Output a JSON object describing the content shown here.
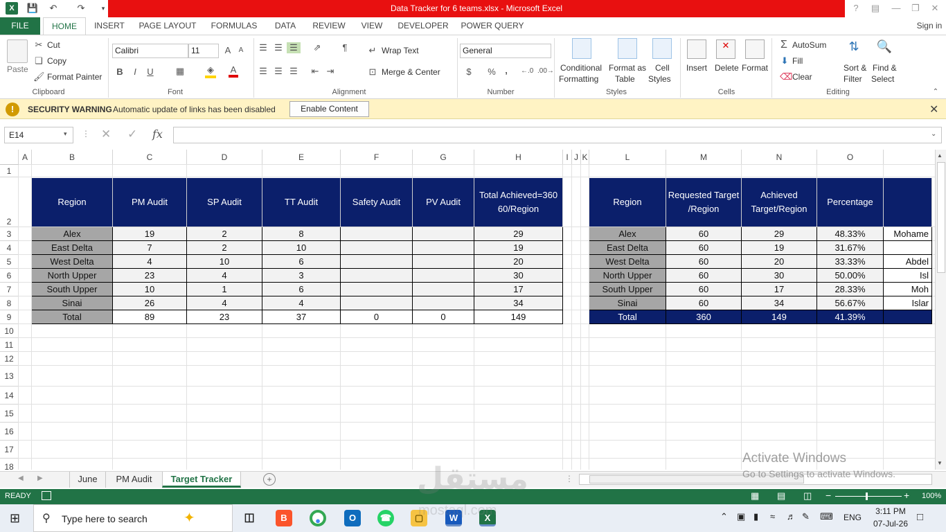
{
  "window": {
    "title": "Data Tracker for 6 teams.xlsx -  Microsoft Excel",
    "help": "?"
  },
  "tabs": [
    "FILE",
    "HOME",
    "INSERT",
    "PAGE LAYOUT",
    "FORMULAS",
    "DATA",
    "REVIEW",
    "VIEW",
    "DEVELOPER",
    "POWER QUERY"
  ],
  "signin": "Sign in",
  "ribbon": {
    "clipboard": {
      "paste": "Paste",
      "cut": "Cut",
      "copy": "Copy",
      "format_painter": "Format Painter",
      "label": "Clipboard"
    },
    "font": {
      "name": "Calibri",
      "size": "11",
      "bold": "B",
      "italic": "I",
      "underline": "U",
      "label": "Font"
    },
    "alignment": {
      "wrap": "Wrap Text",
      "merge": "Merge & Center",
      "label": "Alignment"
    },
    "number": {
      "format": "General",
      "currency": "$",
      "percent": "%",
      "comma": ",",
      "label": "Number"
    },
    "styles": {
      "conditional_1": "Conditional",
      "conditional_2": "Formatting",
      "format_table_1": "Format as",
      "format_table_2": "Table",
      "cell_styles_1": "Cell",
      "cell_styles_2": "Styles",
      "label": "Styles"
    },
    "cells": {
      "insert": "Insert",
      "delete": "Delete",
      "format": "Format",
      "label": "Cells"
    },
    "editing": {
      "autosum": "AutoSum",
      "fill": "Fill",
      "clear": "Clear",
      "sort_1": "Sort &",
      "sort_2": "Filter",
      "find_1": "Find &",
      "find_2": "Select",
      "label": "Editing"
    }
  },
  "security": {
    "title": "SECURITY WARNING",
    "message": "Automatic update of links has been disabled",
    "button": "Enable Content"
  },
  "formula_bar": {
    "name_box": "E14",
    "fx": "fx",
    "value": ""
  },
  "columns": [
    "A",
    "B",
    "C",
    "D",
    "E",
    "F",
    "G",
    "H",
    "I",
    "J",
    "K",
    "L",
    "M",
    "N",
    "O"
  ],
  "rows": [
    "1",
    "2",
    "3",
    "4",
    "5",
    "6",
    "7",
    "8",
    "9",
    "10",
    "11",
    "12",
    "13",
    "14",
    "15",
    "16",
    "17",
    "18"
  ],
  "table1": {
    "headers": [
      "Region",
      "PM Audit",
      "SP Audit",
      "TT Audit",
      "Safety Audit",
      "PV Audit",
      "Total Achieved=360 60/Region"
    ],
    "rows": [
      [
        "Alex",
        "19",
        "2",
        "8",
        "",
        "",
        "29"
      ],
      [
        "East Delta",
        "7",
        "2",
        "10",
        "",
        "",
        "19"
      ],
      [
        "West Delta",
        "4",
        "10",
        "6",
        "",
        "",
        "20"
      ],
      [
        "North Upper",
        "23",
        "4",
        "3",
        "",
        "",
        "30"
      ],
      [
        "South Upper",
        "10",
        "1",
        "6",
        "",
        "",
        "17"
      ],
      [
        "Sinai",
        "26",
        "4",
        "4",
        "",
        "",
        "34"
      ],
      [
        "Total",
        "89",
        "23",
        "37",
        "0",
        "0",
        "149"
      ]
    ]
  },
  "table2": {
    "headers": [
      "Region",
      "Requested Target /Region",
      "Achieved Target/Region",
      "Percentage",
      ""
    ],
    "rows": [
      [
        "Alex",
        "60",
        "29",
        "48.33%",
        "Mohame"
      ],
      [
        "East Delta",
        "60",
        "19",
        "31.67%",
        ""
      ],
      [
        "West Delta",
        "60",
        "20",
        "33.33%",
        "Abdel"
      ],
      [
        "North Upper",
        "60",
        "30",
        "50.00%",
        "Isl"
      ],
      [
        "South Upper",
        "60",
        "17",
        "28.33%",
        "Moh"
      ],
      [
        "Sinai",
        "60",
        "34",
        "56.67%",
        "Islar"
      ],
      [
        "Total",
        "360",
        "149",
        "41.39%",
        ""
      ]
    ]
  },
  "sheet_tabs": [
    "June",
    "PM Audit",
    "Target Tracker"
  ],
  "active_sheet": "Target Tracker",
  "status": {
    "ready": "READY",
    "zoom": "100%"
  },
  "activate": {
    "line1": "Activate Windows",
    "line2": "Go to Settings to activate Windows."
  },
  "taskbar": {
    "search": "Type here to search",
    "lang": "ENG",
    "time": "3:11 PM",
    "date": "07-Jul-26"
  },
  "watermark": {
    "arabic": "مستقل",
    "latin": "mostaql.com"
  },
  "colors": {
    "excel_green": "#217346",
    "title_red": "#e81010",
    "header_navy": "#0b1f6b",
    "region_gray": "#a6a6a6"
  }
}
